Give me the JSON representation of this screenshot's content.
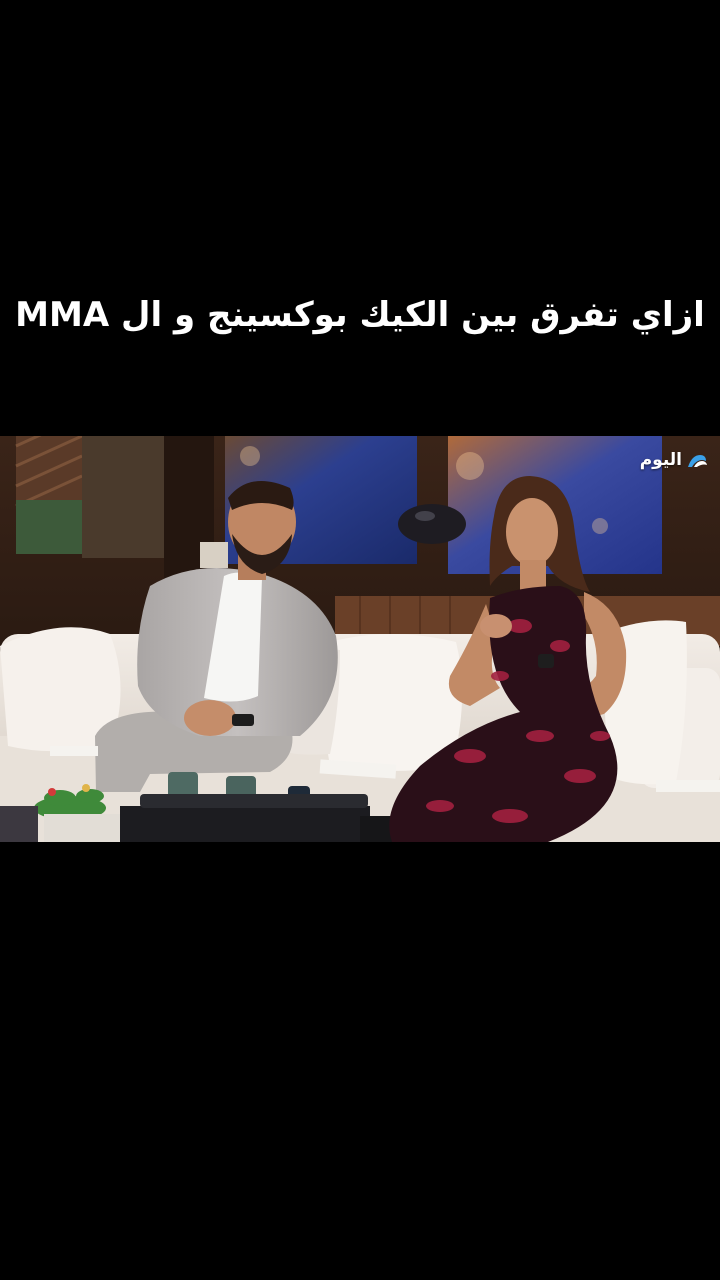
{
  "caption": {
    "text": "ازاي تفرق بين الكيك بوكسينج و ال MMA"
  },
  "video": {
    "channel_logo_text": "اليوم",
    "channel_logo_icon": "channel-wave-icon"
  },
  "colors": {
    "background": "#000000",
    "caption_text": "#ffffff",
    "sofa": "#ece6df",
    "jacket": "#b9b5b4",
    "dress_dark": "#2a0f18",
    "dress_accent": "#a2203f",
    "screen_blue": "#2b4aa6"
  }
}
